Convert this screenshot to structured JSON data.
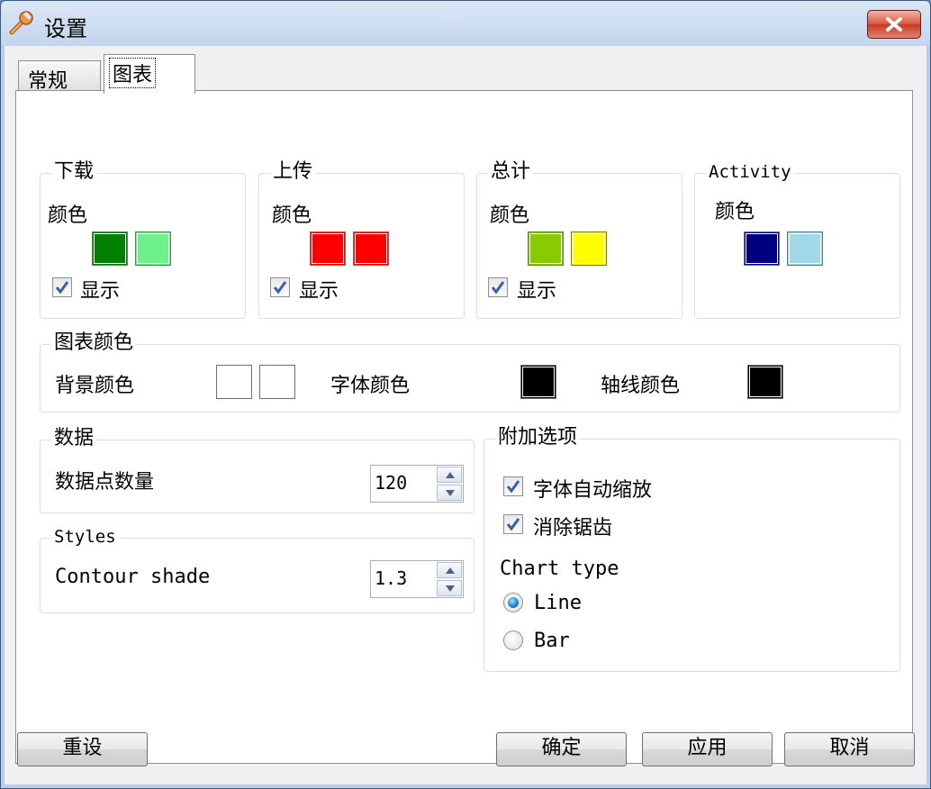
{
  "window": {
    "title": "设置",
    "close_label": "✕"
  },
  "tabs": [
    {
      "label": "常规"
    },
    {
      "label": "图表"
    }
  ],
  "groups": {
    "download": {
      "title": "下载",
      "color_label": "颜色",
      "colors": [
        "#008000",
        "#6ef08a"
      ],
      "show_label": "显示",
      "show_checked": true
    },
    "upload": {
      "title": "上传",
      "color_label": "颜色",
      "colors": [
        "#ff0000",
        "#ff0000"
      ],
      "show_label": "显示",
      "show_checked": true
    },
    "total": {
      "title": "总计",
      "color_label": "颜色",
      "colors": [
        "#88cc00",
        "#ffff00"
      ],
      "show_label": "显示",
      "show_checked": true
    },
    "activity": {
      "title": "Activity",
      "color_label": "颜色",
      "colors": [
        "#000080",
        "#a3d8e8"
      ]
    }
  },
  "chart_colors": {
    "title": "图表颜色",
    "background_label": "背景颜色",
    "background_colors": [
      "#ffffff",
      "#ffffff"
    ],
    "font_label": "字体颜色",
    "font_color": "#000000",
    "axis_label": "轴线颜色",
    "axis_color": "#000000"
  },
  "data_group": {
    "title": "数据",
    "points_label": "数据点数量",
    "points_value": "120"
  },
  "styles_group": {
    "title": "Styles",
    "contour_label": "Contour shade",
    "contour_value": "1.3"
  },
  "extra_options": {
    "title": "附加选项",
    "font_autoscale_label": "字体自动缩放",
    "font_autoscale_checked": true,
    "antialias_label": "消除锯齿",
    "antialias_checked": true,
    "chart_type_label": "Chart type",
    "line_label": "Line",
    "bar_label": "Bar",
    "selected": "Line"
  },
  "buttons": {
    "reset": "重设",
    "ok": "确定",
    "apply": "应用",
    "cancel": "取消"
  }
}
